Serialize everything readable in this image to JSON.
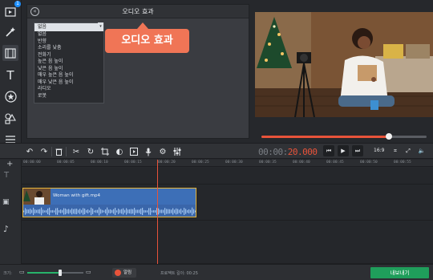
{
  "colors": {
    "accent": "#e8533a",
    "callout": "#f07556",
    "clip": "#3d6fb7",
    "clip_border": "#e5b43a",
    "export": "#1f9e5b",
    "zoom": "#27b36a"
  },
  "left_toolbar": {
    "items": [
      {
        "icon": "media-import-icon",
        "badge": "1"
      },
      {
        "icon": "magic-wand-icon"
      },
      {
        "icon": "film-strip-icon"
      },
      {
        "icon": "text-icon",
        "glyph": "T"
      },
      {
        "icon": "star-sticker-icon"
      },
      {
        "icon": "shapes-icon"
      },
      {
        "icon": "list-icon"
      }
    ]
  },
  "panel": {
    "title": "오디오 효과",
    "selected": "없음",
    "options": [
      "없음",
      "반향",
      "소리를 낮춤",
      "전화기",
      "높은 음 높이",
      "낮은 음 높이",
      "매우 높은 음 높이",
      "매우 낮은 음 높이",
      "라디오",
      "로봇"
    ]
  },
  "callout": {
    "text": "오디오 효과"
  },
  "preview": {
    "progress": 0.77
  },
  "playback": {
    "timecode_dim": "00:00:",
    "timecode_hot": "20.000",
    "aspect": "16:9"
  },
  "timeline": {
    "ticks": [
      "00:00:00",
      "00:00:05",
      "00:00:10",
      "00:00:15",
      "00:00:20",
      "00:00:25",
      "00:00:30",
      "00:00:35",
      "00:00:40",
      "00:00:45",
      "00:00:50",
      "00:00:55"
    ],
    "clip_name": "Woman with gift.mp4"
  },
  "bottom": {
    "scale_label": "크기:",
    "zoom": 0.58,
    "notify_label": "알림",
    "project_length": "프로젝트 길이:  00:25",
    "export_label": "내보내기"
  }
}
